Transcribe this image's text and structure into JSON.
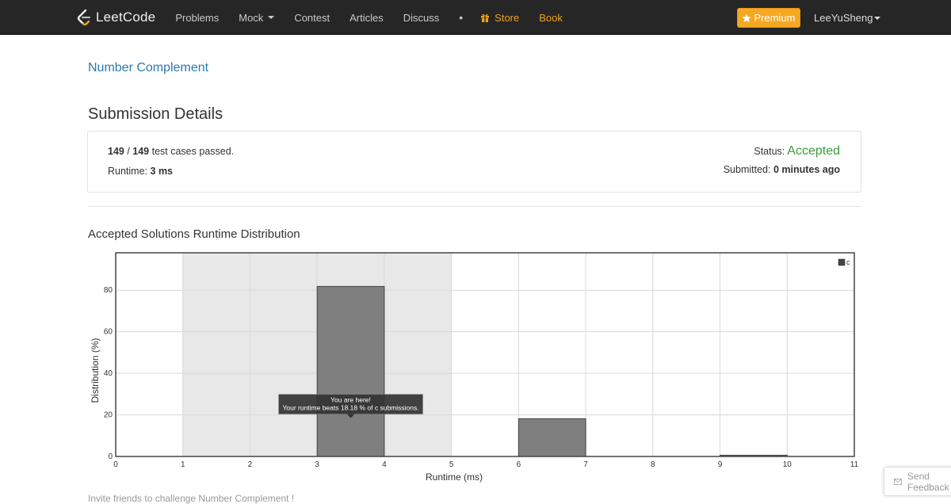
{
  "nav": {
    "brand": "LeetCode",
    "items": [
      {
        "label": "Problems",
        "caret": false
      },
      {
        "label": "Mock",
        "caret": true
      },
      {
        "label": "Contest",
        "caret": false
      },
      {
        "label": "Articles",
        "caret": false
      },
      {
        "label": "Discuss",
        "caret": false
      }
    ],
    "dot": "•",
    "store": "Store",
    "book": "Book",
    "premium": "Premium",
    "username": "LeeYuSheng",
    "colors": {
      "bar": "#262626",
      "accent": "#f0a020",
      "premium": "#f6a821"
    }
  },
  "problem_link": "Number Complement",
  "page_title": "Submission Details",
  "submission": {
    "passed": "149",
    "total": "149",
    "passed_suffix": " test cases passed.",
    "runtime_label": "Runtime:",
    "runtime_value": "3 ms",
    "status_label": "Status:",
    "status_value": "Accepted",
    "submitted_label": "Submitted:",
    "submitted_value": "0 minutes ago",
    "status_color": "#3c9a3c"
  },
  "chart_title": "Accepted Solutions Runtime Distribution",
  "tooltip": {
    "line1": "You are here!",
    "line2": "Your runtime beats 18.18 % of c submissions."
  },
  "chart_data": {
    "type": "bar",
    "title": "Accepted Solutions Runtime Distribution",
    "xlabel": "Runtime (ms)",
    "ylabel": "Distribution (%)",
    "xlim": [
      0,
      11
    ],
    "ylim": [
      0,
      98
    ],
    "x_ticks": [
      0,
      1,
      2,
      3,
      4,
      5,
      6,
      7,
      8,
      9,
      10,
      11
    ],
    "y_ticks": [
      0,
      20,
      40,
      60,
      80
    ],
    "highlight_range": [
      1,
      5
    ],
    "grid": true,
    "legend": "top-right",
    "series": [
      {
        "name": "c",
        "color": "#7f7f7f",
        "bins": [
          {
            "x0": 3,
            "x1": 4,
            "value": 81.82
          },
          {
            "x0": 6,
            "x1": 7,
            "value": 18.18
          },
          {
            "x0": 9,
            "x1": 10,
            "value": 0.6
          }
        ]
      }
    ]
  },
  "invite_text": "Invite friends to challenge Number Complement !",
  "feedback": "Send Feedback"
}
